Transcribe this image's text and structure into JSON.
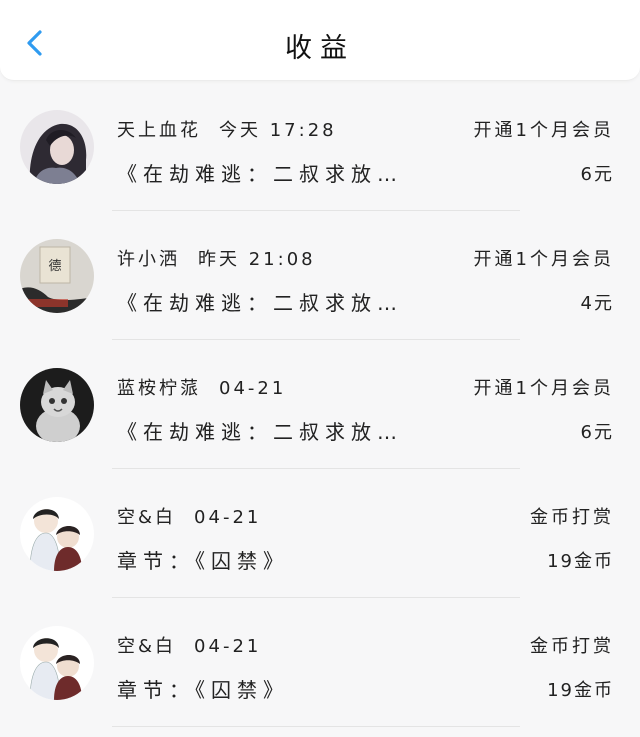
{
  "header": {
    "title": "收益"
  },
  "items": [
    {
      "name": "天上血花",
      "time": "今天 17:28",
      "type": "开通1个月会员",
      "detail": "《在劫难逃：二叔求放…",
      "amount": "6元"
    },
    {
      "name": "许小洒",
      "time": "昨天 21:08",
      "type": "开通1个月会员",
      "detail": "《在劫难逃：二叔求放…",
      "amount": "4元"
    },
    {
      "name": "蓝桉柠蒎",
      "time": "04-21",
      "type": "开通1个月会员",
      "detail": "《在劫难逃：二叔求放…",
      "amount": "6元"
    },
    {
      "name": "空&白",
      "time": "04-21",
      "type": "金币打赏",
      "detail": "章节：《囚禁》",
      "amount": "19金币"
    },
    {
      "name": "空&白",
      "time": "04-21",
      "type": "金币打赏",
      "detail": "章节：《囚禁》",
      "amount": "19金币"
    }
  ],
  "colors": {
    "accent": "#2f9bf0"
  }
}
